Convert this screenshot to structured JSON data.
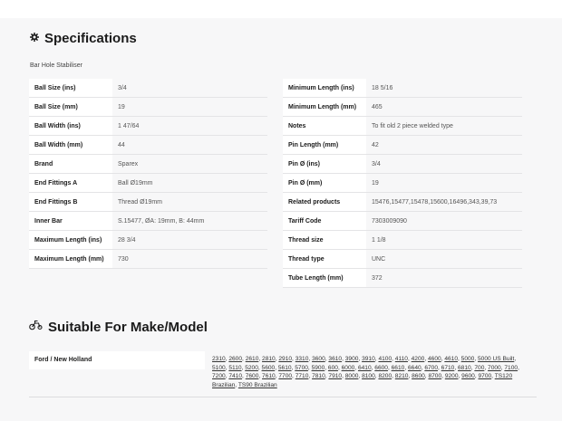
{
  "specifications": {
    "title": "Specifications",
    "subtitle": "Bar Hole Stabiliser",
    "icon": "gear-icon",
    "left": [
      {
        "label": "Ball Size (ins)",
        "value": "3/4"
      },
      {
        "label": "Ball Size (mm)",
        "value": "19"
      },
      {
        "label": "Ball Width (ins)",
        "value": "1 47/64"
      },
      {
        "label": "Ball Width (mm)",
        "value": "44"
      },
      {
        "label": "Brand",
        "value": "Sparex"
      },
      {
        "label": "End Fittings A",
        "value": "Ball Ø19mm"
      },
      {
        "label": "End Fittings B",
        "value": "Thread Ø19mm"
      },
      {
        "label": "Inner Bar",
        "value": "S.15477, ØA: 19mm, B: 44mm"
      },
      {
        "label": "Maximum Length (ins)",
        "value": "28 3/4"
      },
      {
        "label": "Maximum Length (mm)",
        "value": "730"
      }
    ],
    "right": [
      {
        "label": "Minimum Length (ins)",
        "value": "18 5/16"
      },
      {
        "label": "Minimum Length (mm)",
        "value": "465"
      },
      {
        "label": "Notes",
        "value": "To fit old 2 piece welded type"
      },
      {
        "label": "Pin Length (mm)",
        "value": "42"
      },
      {
        "label": "Pin Ø (ins)",
        "value": "3/4"
      },
      {
        "label": "Pin Ø (mm)",
        "value": "19"
      },
      {
        "label": "Related products",
        "value": "15476,15477,15478,15600,16496,343,39,73"
      },
      {
        "label": "Tariff Code",
        "value": "7303009090"
      },
      {
        "label": "Thread size",
        "value": "1 1/8"
      },
      {
        "label": "Thread type",
        "value": "UNC"
      },
      {
        "label": "Tube Length (mm)",
        "value": "372"
      }
    ]
  },
  "make_model": {
    "title": "Suitable For Make/Model",
    "icon": "tractor-icon",
    "make": "Ford / New Holland",
    "models": [
      "2310",
      "2600",
      "2610",
      "2810",
      "2910",
      "3310",
      "3600",
      "3610",
      "3900",
      "3910",
      "4100",
      "4110",
      "4200",
      "4600",
      "4610",
      "5000",
      "5000 US Built",
      "5100",
      "5110",
      "5200",
      "5600",
      "5610",
      "5700",
      "5900",
      "600",
      "6000",
      "6410",
      "6600",
      "6610",
      "6640",
      "6700",
      "6710",
      "6810",
      "700",
      "7000",
      "7100",
      "7200",
      "7410",
      "7600",
      "7610",
      "7700",
      "7710",
      "7810",
      "7910",
      "8000",
      "8100",
      "8200",
      "8210",
      "8600",
      "8700",
      "9200",
      "9600",
      "9700",
      "TS120 Brazilian",
      "TS90 Brazilian"
    ]
  }
}
